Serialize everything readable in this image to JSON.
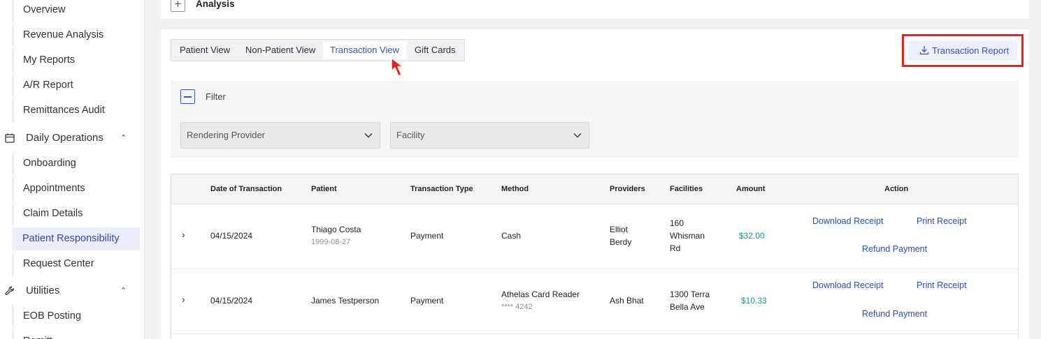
{
  "sidebar": {
    "items": [
      {
        "label": "Overview"
      },
      {
        "label": "Revenue Analysis"
      },
      {
        "label": "My Reports"
      },
      {
        "label": "A/R Report"
      },
      {
        "label": "Remittances Audit"
      }
    ],
    "daily_operations": {
      "label": "Daily Operations",
      "icon": "calendar-icon",
      "items": [
        {
          "label": "Onboarding"
        },
        {
          "label": "Appointments"
        },
        {
          "label": "Claim Details"
        },
        {
          "label": "Patient Responsibility",
          "active": true
        },
        {
          "label": "Request Center"
        }
      ]
    },
    "utilities": {
      "label": "Utilities",
      "icon": "wrench-icon",
      "items": [
        {
          "label": "EOB Posting"
        },
        {
          "label": "Remitt..."
        }
      ]
    }
  },
  "analysis": {
    "label": "Analysis"
  },
  "tabs": [
    {
      "label": "Patient View"
    },
    {
      "label": "Non-Patient View"
    },
    {
      "label": "Transaction View",
      "active": true
    },
    {
      "label": "Gift Cards"
    }
  ],
  "report_button": {
    "label": "Transaction Report",
    "icon": "download-icon"
  },
  "filter": {
    "label": "Filter",
    "selects": [
      {
        "placeholder": "Rendering Provider"
      },
      {
        "placeholder": "Facility"
      }
    ]
  },
  "table": {
    "headers": [
      "Date of Transaction",
      "Patient",
      "Transaction Type",
      "Method",
      "Providers",
      "Facilities",
      "Amount",
      "Action"
    ],
    "rows": [
      {
        "date": "04/15/2024",
        "patient": "Thiago Costa",
        "patient_sub": "1999-08-27",
        "type": "Payment",
        "method": "Cash",
        "method_sub": "",
        "provider": "Elliot Berdy",
        "facility": "160 Whisman Rd",
        "amount": "$32.00",
        "actions": {
          "download": "Download Receipt",
          "print": "Print Receipt",
          "refund": "Refund Payment"
        }
      },
      {
        "date": "04/15/2024",
        "patient": "James Testperson",
        "patient_sub": "",
        "type": "Payment",
        "method": "Athelas Card Reader",
        "method_sub": "**** 4242",
        "provider": "Ash Bhat",
        "facility": "1300 Terra Bella Ave",
        "amount": "$10.33",
        "actions": {
          "download": "Download Receipt",
          "print": "Print Receipt",
          "refund": "Refund Payment"
        }
      }
    ]
  },
  "colors": {
    "accent": "#3a4fc0",
    "highlight": "#e8201e",
    "amount": "#1f8f94"
  }
}
